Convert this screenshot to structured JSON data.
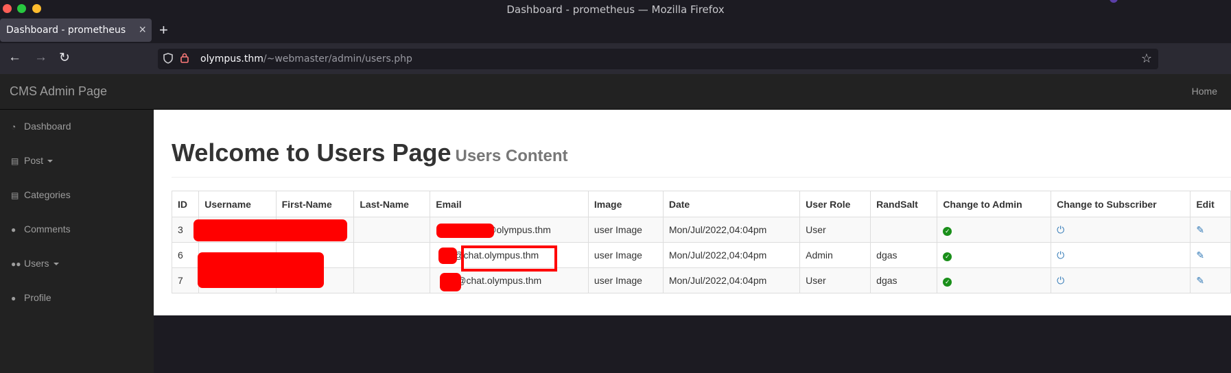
{
  "window": {
    "title": "Dashboard - prometheus — Mozilla Firefox"
  },
  "tab": {
    "label": "Dashboard - prometheus",
    "close": "×",
    "new_tab": "+"
  },
  "nav": {
    "back": "←",
    "forward": "→",
    "reload": "↻"
  },
  "address": {
    "host": "olympus.thm",
    "path": "/~webmaster/admin/users.php"
  },
  "header": {
    "brand": "CMS Admin Page",
    "home": "Home"
  },
  "sidebar": {
    "items": [
      {
        "label": "Dashboard",
        "icon": "dashboard-icon"
      },
      {
        "label": "Post",
        "icon": "file-icon",
        "dropdown": true
      },
      {
        "label": "Categories",
        "icon": "file-icon"
      },
      {
        "label": "Comments",
        "icon": "comments-icon"
      },
      {
        "label": "Users",
        "icon": "users-icon",
        "dropdown": true
      },
      {
        "label": "Profile",
        "icon": "user-icon"
      }
    ]
  },
  "page": {
    "title": "Welcome to Users Page",
    "subtitle": "Users Content"
  },
  "table": {
    "columns": [
      "ID",
      "Username",
      "First-Name",
      "Last-Name",
      "Email",
      "Image",
      "Date",
      "User Role",
      "RandSalt",
      "Change to Admin",
      "Change to Subscriber",
      "Edit"
    ],
    "rows": [
      {
        "id": "3",
        "email": "@olympus.thm",
        "image": "user Image",
        "date": "Mon/Jul/2022,04:04pm",
        "role": "User",
        "salt": ""
      },
      {
        "id": "6",
        "email": "@chat.olympus.thm",
        "image": "user Image",
        "date": "Mon/Jul/2022,04:04pm",
        "role": "Admin",
        "salt": "dgas"
      },
      {
        "id": "7",
        "email": "@chat.olympus.thm",
        "image": "user Image",
        "date": "Mon/Jul/2022,04:04pm",
        "role": "User",
        "salt": "dgas"
      }
    ]
  },
  "colors": {
    "redaction": "#ff0000",
    "header_bg": "#222222",
    "check_green": "#1a8f1a",
    "link_blue": "#337ab7"
  }
}
